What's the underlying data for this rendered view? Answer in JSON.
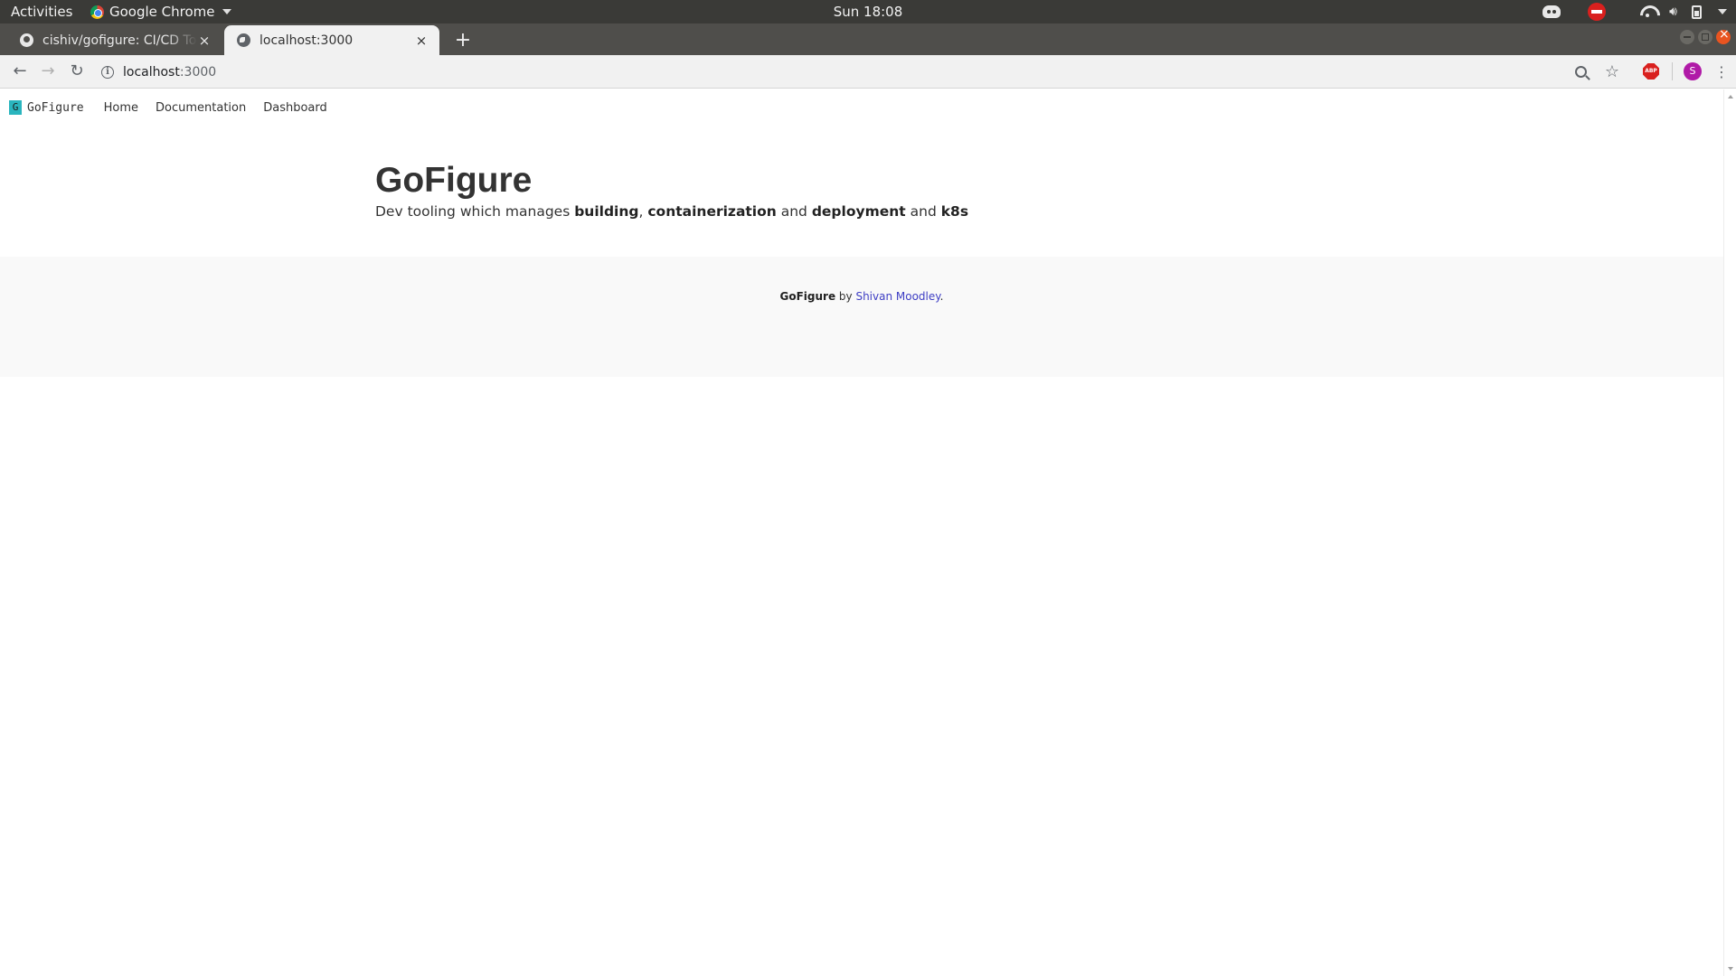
{
  "system": {
    "activities": "Activities",
    "app_menu": "Google Chrome",
    "clock": "Sun 18:08",
    "tray_icons": [
      "discord-icon",
      "blocked-icon",
      "wifi-icon",
      "volume-icon",
      "battery-icon",
      "system-menu-icon"
    ]
  },
  "browser": {
    "tabs": [
      {
        "title": "cishiv/gofigure: CI/CD Tool",
        "favicon": "github-icon",
        "active": false
      },
      {
        "title": "localhost:3000",
        "favicon": "globe-icon",
        "active": true
      }
    ],
    "new_tab": "+",
    "close_glyph": "×",
    "back": "←",
    "forward": "→",
    "reload": "↻",
    "url_host": "localhost",
    "url_port": ":3000",
    "info_glyph": "i",
    "star_glyph": "☆",
    "abp_label": "ABP",
    "profile_initial": "S",
    "menu_glyph": "⋮",
    "colors": {
      "profile": "#b01aa7",
      "abp": "#d9201e",
      "close_window": "#e95420"
    }
  },
  "site": {
    "logo_letter": "G",
    "brand": "GoFigure",
    "nav": {
      "home": "Home",
      "docs": "Documentation",
      "dashboard": "Dashboard"
    },
    "hero": {
      "title": "GoFigure",
      "sub_prefix": "Dev tooling which manages ",
      "building": "building",
      "comma": ", ",
      "containerization": "containerization",
      "and1": " and ",
      "deployment": "deployment",
      "and2": " and ",
      "k8s": "k8s"
    },
    "footer": {
      "brand": "GoFigure",
      "by": " by ",
      "author": "Shivan Moodley",
      "period": "."
    },
    "colors": {
      "logo": "#2ab5be",
      "link": "#3e3ec4",
      "footer_bg": "#f9f9f9"
    }
  }
}
